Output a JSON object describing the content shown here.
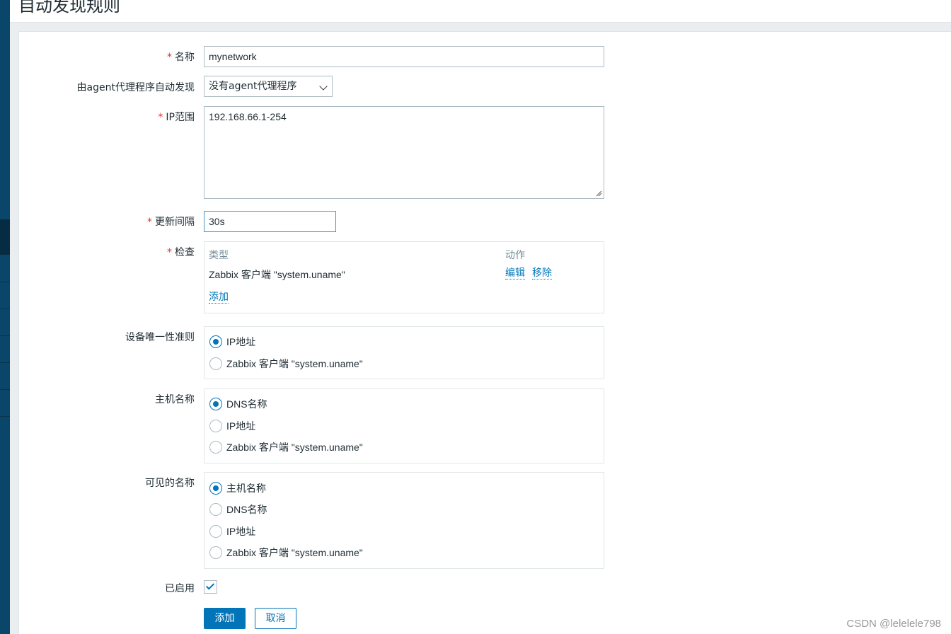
{
  "page": {
    "title": "自动发现规则"
  },
  "form": {
    "name": {
      "label": "名称",
      "value": "mynetwork"
    },
    "proxy": {
      "label": "由agent代理程序自动发现",
      "value": "没有agent代理程序"
    },
    "ip_range": {
      "label": "IP范围",
      "value": "192.168.66.1-254"
    },
    "interval": {
      "label": "更新间隔",
      "value": "30s"
    },
    "checks": {
      "label": "检查",
      "col_type": "类型",
      "col_action": "动作",
      "rows": [
        {
          "type": "Zabbix 客户端 \"system.uname\"",
          "edit": "编辑",
          "remove": "移除"
        }
      ],
      "add": "添加"
    },
    "uniqueness": {
      "label": "设备唯一性准则",
      "options": [
        "IP地址",
        "Zabbix 客户端 \"system.uname\""
      ],
      "selected": "IP地址"
    },
    "host_name": {
      "label": "主机名称",
      "options": [
        "DNS名称",
        "IP地址",
        "Zabbix 客户端 \"system.uname\""
      ],
      "selected": "DNS名称"
    },
    "visible_name": {
      "label": "可见的名称",
      "options": [
        "主机名称",
        "DNS名称",
        "IP地址",
        "Zabbix 客户端 \"system.uname\""
      ],
      "selected": "主机名称"
    },
    "enabled": {
      "label": "已启用",
      "checked": true
    },
    "buttons": {
      "add": "添加",
      "cancel": "取消"
    }
  },
  "watermark": "CSDN @lelelele798",
  "colors": {
    "accent": "#0275b8",
    "required": "#e33734",
    "sidebar": "#0a466a"
  }
}
